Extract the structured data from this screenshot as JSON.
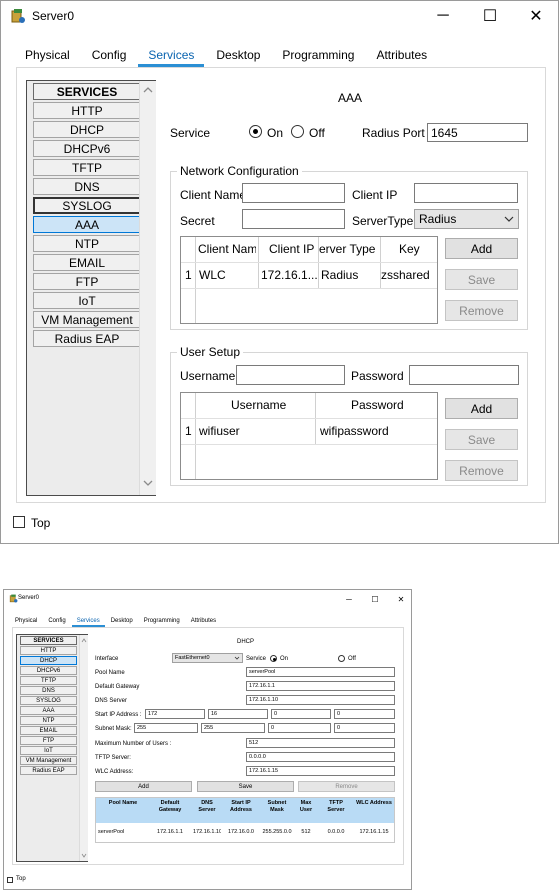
{
  "windows": [
    {
      "title": "Server0",
      "controls": {
        "minimize": "─",
        "maximize": "☐",
        "close": "✕"
      },
      "tabs": [
        "Physical",
        "Config",
        "Services",
        "Desktop",
        "Programming",
        "Attributes"
      ],
      "active_tab": "Services",
      "services": [
        "SERVICES",
        "HTTP",
        "DHCP",
        "DHCPv6",
        "TFTP",
        "DNS",
        "SYSLOG",
        "AAA",
        "NTP",
        "EMAIL",
        "FTP",
        "IoT",
        "VM Management",
        "Radius EAP"
      ],
      "selected_service": "AAA",
      "heading": "AAA",
      "service_label": "Service",
      "on_label": "On",
      "off_label": "Off",
      "service_state": "On",
      "radius_port_label": "Radius Port",
      "radius_port_value": "1645",
      "network_config": {
        "title": "Network Configuration",
        "client_name_label": "Client Name",
        "client_name_value": "",
        "client_ip_label": "Client IP",
        "client_ip_value": "",
        "secret_label": "Secret",
        "secret_value": "",
        "server_type_label": "ServerType",
        "server_type_value": "Radius",
        "columns": [
          "Client Name",
          "Client IP",
          "Server Type",
          "Key"
        ],
        "columns_visible": [
          "Client Name",
          "Client IP",
          "Server Type",
          "Key"
        ],
        "column_header_display": [
          "Client Name",
          "Client IP",
          "erver Type",
          "Key"
        ],
        "rows": [
          {
            "index": "1",
            "client_name": "WLC",
            "client_ip": "172.16.1...",
            "server_type": "Radius",
            "key": "zsshared"
          }
        ],
        "add_label": "Add",
        "save_label": "Save",
        "remove_label": "Remove"
      },
      "user_setup": {
        "title": "User Setup",
        "username_label": "Username",
        "username_value": "",
        "password_label": "Password",
        "password_value": "",
        "columns": [
          "Username",
          "Password"
        ],
        "rows": [
          {
            "index": "1",
            "username": "wifiuser",
            "password": "wifipassword"
          }
        ],
        "add_label": "Add",
        "save_label": "Save",
        "remove_label": "Remove"
      },
      "top_label": "Top",
      "top_checked": false
    },
    {
      "title": "Server0",
      "controls": {
        "minimize": "─",
        "maximize": "☐",
        "close": "✕"
      },
      "tabs": [
        "Physical",
        "Config",
        "Services",
        "Desktop",
        "Programming",
        "Attributes"
      ],
      "active_tab": "Services",
      "services": [
        "SERVICES",
        "HTTP",
        "DHCP",
        "DHCPv6",
        "TFTP",
        "DNS",
        "SYSLOG",
        "AAA",
        "NTP",
        "EMAIL",
        "FTP",
        "IoT",
        "VM Management",
        "Radius EAP"
      ],
      "selected_service": "DHCP",
      "heading": "DHCP",
      "interface_label": "Interface",
      "interface_value": "FastEthernet0",
      "service_label": "Service",
      "on_label": "On",
      "off_label": "Off",
      "service_state": "On",
      "fields": [
        {
          "label": "Pool Name",
          "value": "serverPool"
        },
        {
          "label": "Default Gateway",
          "value": "172.16.1.1"
        },
        {
          "label": "DNS Server",
          "value": "172.16.1.10"
        }
      ],
      "start_ip_label": "Start IP Address :",
      "start_ip": [
        "172",
        "16",
        "0",
        "0"
      ],
      "subnet_mask_label": "Subnet Mask:",
      "subnet_mask": [
        "255",
        "255",
        "0",
        "0"
      ],
      "max_users_label": "Maximum Number of Users :",
      "max_users_value": "512",
      "tftp_label": "TFTP Server:",
      "tftp_value": "0.0.0.0",
      "wlc_label": "WLC Address:",
      "wlc_value": "172.16.1.15",
      "add_label": "Add",
      "save_label": "Save",
      "remove_label": "Remove",
      "pool_columns": [
        "Pool Name",
        "Default Gateway",
        "DNS Server",
        "Start IP Address",
        "Subnet Mask",
        "Max User",
        "TFTP Server",
        "WLC Address"
      ],
      "pool_rows": [
        [
          "serverPool",
          "172.16.1.1",
          "172.16.1.10",
          "172.16.0.0",
          "255.255.0.0",
          "512",
          "0.0.0.0",
          "172.16.1.15"
        ]
      ],
      "top_label": "Top",
      "top_checked": false
    }
  ]
}
